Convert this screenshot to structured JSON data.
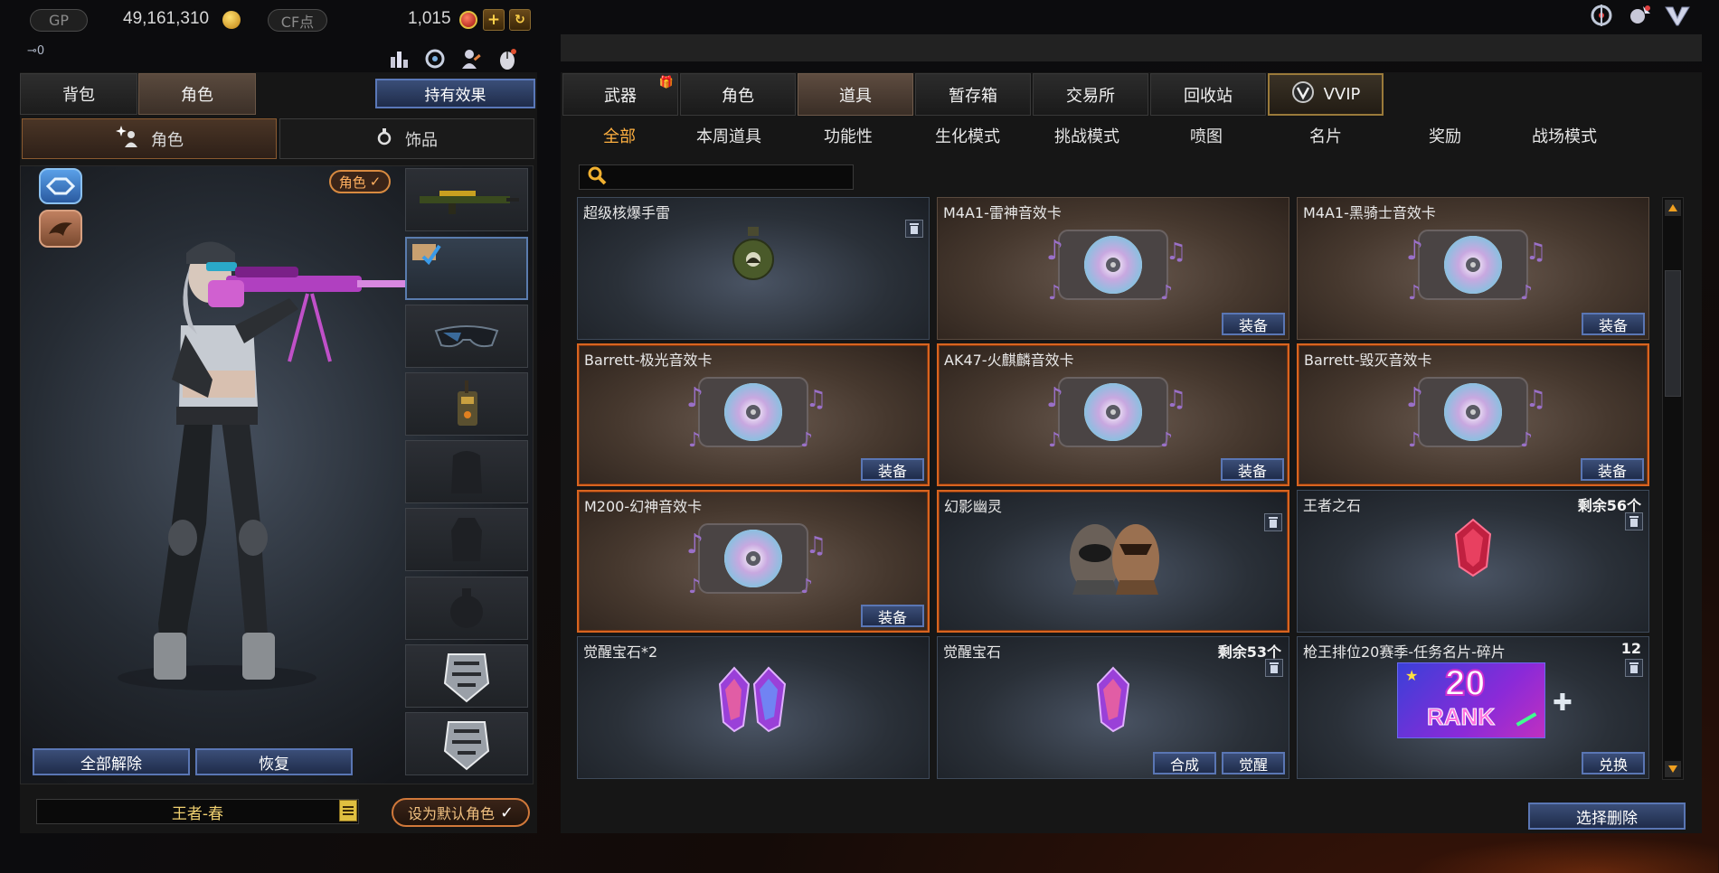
{
  "topbar": {
    "gp_label": "GP",
    "gp_value": "49,161,310",
    "cf_label": "CF点",
    "cf_value": "1,015",
    "key_count": "0"
  },
  "left": {
    "tabs": [
      "背包",
      "角色"
    ],
    "effects_button": "持有效果",
    "subtabs": [
      "角色",
      "饰品"
    ],
    "role_tag": "角色",
    "unequip_all": "全部解除",
    "restore": "恢复",
    "character_name": "王者-春",
    "set_default": "设为默认角色"
  },
  "right": {
    "main_tabs": [
      "武器",
      "角色",
      "道具",
      "暂存箱",
      "交易所",
      "回收站",
      "VVIP"
    ],
    "active_main_tab": 2,
    "categories": [
      "全部",
      "本周道具",
      "功能性",
      "生化模式",
      "挑战模式",
      "喷图",
      "名片",
      "奖励",
      "战场模式"
    ],
    "search_placeholder": "",
    "items": [
      {
        "name": "超级核爆手雷",
        "count": "",
        "button": "",
        "style": "steel",
        "art": "grenade",
        "trash": true
      },
      {
        "name": "M4A1-雷神音效卡",
        "count": "",
        "button": "装备",
        "style": "bronze",
        "art": "cd",
        "trash": false
      },
      {
        "name": "M4A1-黑骑士音效卡",
        "count": "",
        "button": "装备",
        "style": "bronze",
        "art": "cd",
        "trash": false
      },
      {
        "name": "Barrett-极光音效卡",
        "count": "",
        "button": "装备",
        "style": "bronze-eq",
        "art": "cd",
        "trash": false
      },
      {
        "name": "AK47-火麒麟音效卡",
        "count": "",
        "button": "装备",
        "style": "bronze-eq",
        "art": "cd",
        "trash": false
      },
      {
        "name": "Barrett-毁灭音效卡",
        "count": "",
        "button": "装备",
        "style": "bronze-eq",
        "art": "cd",
        "trash": false
      },
      {
        "name": "M200-幻神音效卡",
        "count": "",
        "button": "装备",
        "style": "bronze-eq",
        "art": "cd",
        "trash": false
      },
      {
        "name": "幻影幽灵",
        "count": "",
        "button": "",
        "style": "steel-eq",
        "art": "masks",
        "trash": true
      },
      {
        "name": "王者之石",
        "count": "剩余56个",
        "button": "",
        "style": "steel",
        "art": "ruby",
        "trash": true
      },
      {
        "name": "觉醒宝石*2",
        "count": "",
        "button": "",
        "style": "steel",
        "art": "gems2",
        "trash": false
      },
      {
        "name": "觉醒宝石",
        "count": "剩余53个",
        "button": "觉醒",
        "button2": "合成",
        "style": "steel",
        "art": "gem",
        "trash": true
      },
      {
        "name": "枪王排位20赛季-任务名片-碎片",
        "count": "12",
        "button": "兑换",
        "style": "steel",
        "art": "rank",
        "trash": true
      }
    ],
    "rank_badge_text": "20",
    "rank_badge_sub": "RANK",
    "delete_button": "选择删除"
  },
  "colors": {
    "accent_orange": "#ffb040",
    "equipped_border": "#d86420",
    "button_blue": "#3b4e78"
  }
}
